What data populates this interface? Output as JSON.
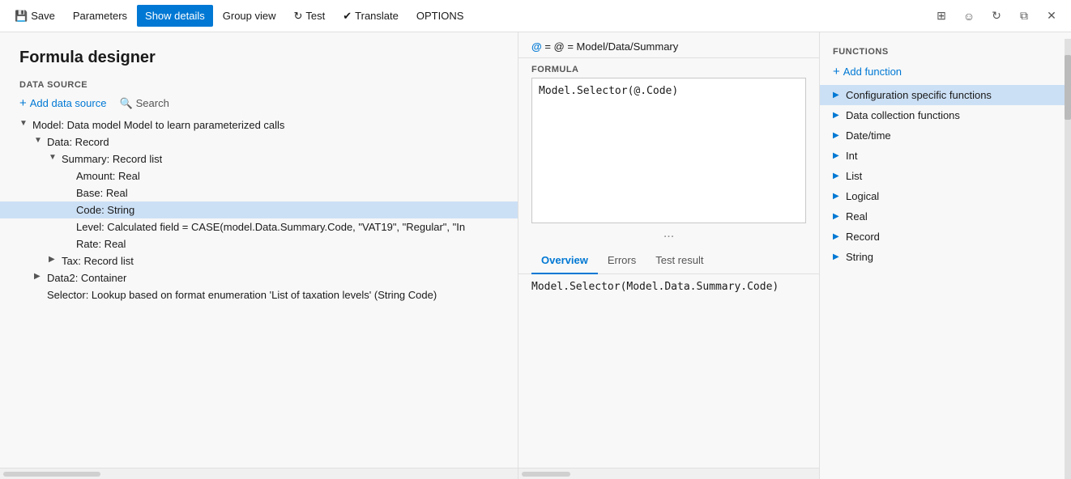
{
  "titlebar": {
    "save_label": "Save",
    "parameters_label": "Parameters",
    "show_details_label": "Show details",
    "group_view_label": "Group view",
    "test_label": "Test",
    "translate_label": "Translate",
    "options_label": "OPTIONS"
  },
  "left_panel": {
    "page_title": "Formula designer",
    "data_source_label": "DATA SOURCE",
    "add_data_source": "Add data source",
    "search_label": "Search",
    "tree": [
      {
        "id": "model",
        "level": 0,
        "expanded": true,
        "chevron": "▼",
        "text": "Model: Data model Model to learn parameterized calls"
      },
      {
        "id": "data",
        "level": 1,
        "expanded": true,
        "chevron": "▼",
        "text": "Data: Record"
      },
      {
        "id": "summary",
        "level": 2,
        "expanded": true,
        "chevron": "▼",
        "text": "Summary: Record list"
      },
      {
        "id": "amount",
        "level": 3,
        "expanded": false,
        "chevron": "",
        "text": "Amount: Real"
      },
      {
        "id": "base",
        "level": 3,
        "expanded": false,
        "chevron": "",
        "text": "Base: Real"
      },
      {
        "id": "code",
        "level": 3,
        "expanded": false,
        "chevron": "",
        "text": "Code: String",
        "selected": true
      },
      {
        "id": "level",
        "level": 3,
        "expanded": false,
        "chevron": "",
        "text": "Level: Calculated field = CASE(model.Data.Summary.Code, \"VAT19\", \"Regular\", \"In"
      },
      {
        "id": "rate",
        "level": 3,
        "expanded": false,
        "chevron": "",
        "text": "Rate: Real"
      },
      {
        "id": "tax",
        "level": 2,
        "expanded": false,
        "chevron": "▶",
        "text": "Tax: Record list"
      },
      {
        "id": "data2",
        "level": 1,
        "expanded": false,
        "chevron": "▶",
        "text": "Data2: Container"
      },
      {
        "id": "selector",
        "level": 1,
        "expanded": false,
        "chevron": "",
        "text": "Selector: Lookup based on format enumeration 'List of taxation levels' (String Code)"
      }
    ]
  },
  "mid_panel": {
    "formula_path": "@ = Model/Data/Summary",
    "formula_label": "FORMULA",
    "formula_text": "Model.Selector(@.Code)",
    "more_indicator": "...",
    "tabs": [
      "Overview",
      "Errors",
      "Test result"
    ],
    "active_tab": "Overview",
    "result_text": "Model.Selector(Model.Data.Summary.Code)"
  },
  "right_panel": {
    "functions_label": "FUNCTIONS",
    "add_function_label": "Add function",
    "function_items": [
      {
        "id": "config",
        "text": "Configuration specific functions",
        "selected": true
      },
      {
        "id": "datacoll",
        "text": "Data collection functions",
        "selected": false
      },
      {
        "id": "datetime",
        "text": "Date/time",
        "selected": false
      },
      {
        "id": "int",
        "text": "Int",
        "selected": false
      },
      {
        "id": "list",
        "text": "List",
        "selected": false
      },
      {
        "id": "logical",
        "text": "Logical",
        "selected": false
      },
      {
        "id": "real",
        "text": "Real",
        "selected": false
      },
      {
        "id": "record",
        "text": "Record",
        "selected": false
      },
      {
        "id": "string",
        "text": "String",
        "selected": false
      }
    ]
  },
  "icons": {
    "save": "💾",
    "refresh": "↺",
    "translate": "✈",
    "search": "🔍",
    "plus": "+",
    "grid": "⊞",
    "user": "👤",
    "window": "⧉",
    "close": "✕",
    "chevron_right": "▶",
    "chevron_down": "▼"
  }
}
